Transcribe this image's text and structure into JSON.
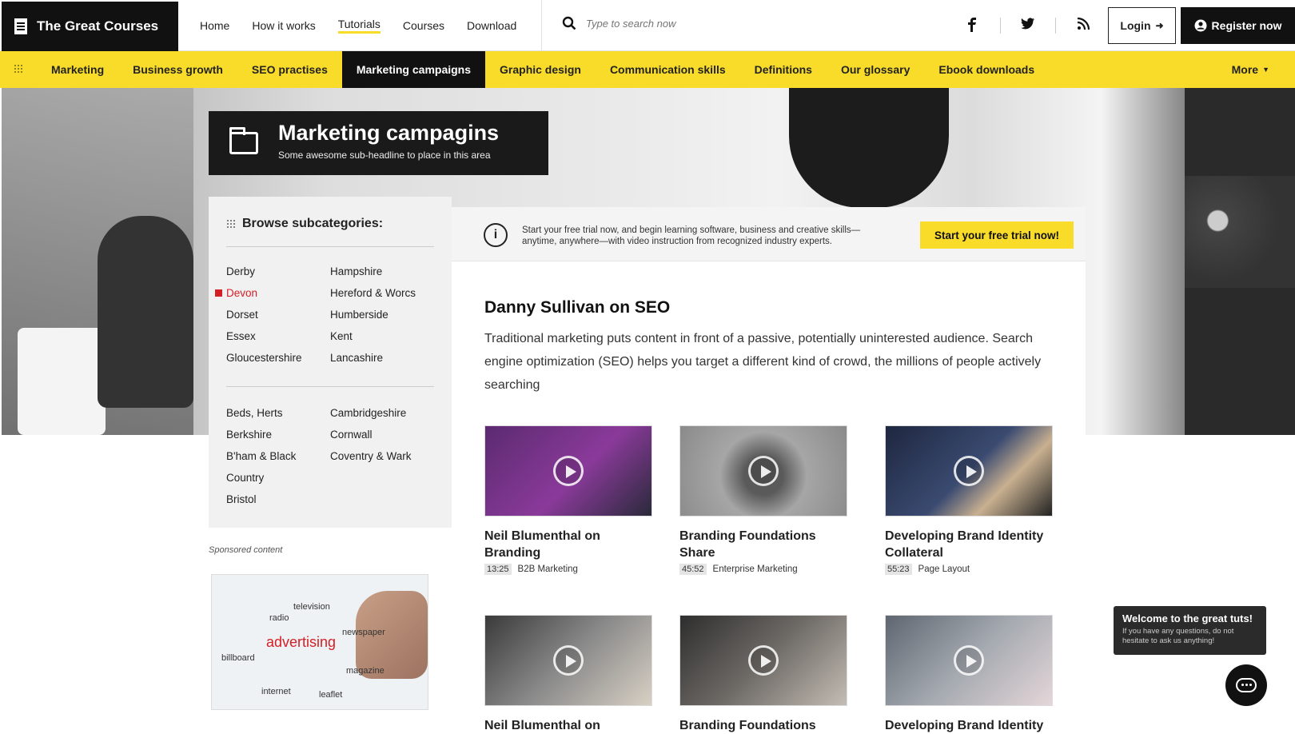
{
  "brand": {
    "name": "The Great Courses"
  },
  "nav": [
    {
      "label": "Home"
    },
    {
      "label": "How it works"
    },
    {
      "label": "Tutorials",
      "active": true
    },
    {
      "label": "Courses"
    },
    {
      "label": "Download"
    }
  ],
  "search": {
    "placeholder": "Type to search now"
  },
  "social": {
    "facebook": "f",
    "twitter": "t",
    "rss": "rss"
  },
  "auth": {
    "login": "Login",
    "register": "Register now"
  },
  "categories": [
    "Marketing",
    "Business growth",
    "SEO practises",
    "Marketing campaigns",
    "Graphic design",
    "Communication skills",
    "Definitions",
    "Our glossary",
    "Ebook downloads"
  ],
  "active_category": "Marketing campaigns",
  "more_label": "More",
  "hero": {
    "title": "Marketing campagins",
    "subtitle": "Some awesome sub-headline to place in this area"
  },
  "sidebar": {
    "heading": "Browse subcategories:",
    "group1": {
      "col1": [
        "Derby",
        "Devon",
        "Dorset",
        "Essex",
        "Gloucestershire"
      ],
      "col2": [
        "Hampshire",
        "Hereford & Worcs",
        "Humberside",
        "Kent",
        "Lancashire"
      ]
    },
    "group2": {
      "col1": [
        "Beds, Herts",
        "Berkshire",
        "B'ham & Black",
        "Country",
        "Bristol"
      ],
      "col2": [
        "Cambridgeshire",
        "Cornwall",
        "Coventry & Wark"
      ]
    },
    "selected": "Devon"
  },
  "sponsored": {
    "label": "Sponsored content",
    "words": [
      "radio",
      "television",
      "newspaper",
      "advertising",
      "billboard",
      "magazine",
      "internet",
      "leaflet"
    ]
  },
  "trial": {
    "text": "Start your free trial now, and begin learning software, business and creative skills—anytime, anywhere—with video instruction from recognized industry experts.",
    "button": "Start your free trial now!"
  },
  "article": {
    "title": "Danny Sullivan on SEO",
    "description": "Traditional marketing puts content in front of a passive, potentially uninterested audience. Search engine optimization (SEO) helps you target a different kind of crowd, the millions of people actively searching"
  },
  "videos": [
    {
      "title": "Neil Blumenthal on Branding",
      "duration": "13:25",
      "category": "B2B Marketing",
      "thumb_color": "#5b2a70"
    },
    {
      "title": "Branding Foundations Share",
      "duration": "45:52",
      "category": "Enterprise Marketing",
      "thumb_color": "#9a9a9a"
    },
    {
      "title": "Developing Brand Identity Collateral",
      "duration": "55:23",
      "category": "Page Layout",
      "thumb_color": "#2a3550"
    },
    {
      "title": "Neil Blumenthal on",
      "duration": "",
      "category": "",
      "thumb_color": "#6a6a6a"
    },
    {
      "title": "Branding Foundations",
      "duration": "",
      "category": "",
      "thumb_color": "#5a5a5a"
    },
    {
      "title": "Developing Brand Identity",
      "duration": "",
      "category": "",
      "thumb_color": "#8a8f99"
    }
  ],
  "chat": {
    "title": "Welcome to the great tuts!",
    "message": "If you have any questions, do  not hesitate to ask us anything!"
  },
  "colors": {
    "accent": "#f9dc2a",
    "dark": "#111111",
    "selected": "#d41f26"
  }
}
